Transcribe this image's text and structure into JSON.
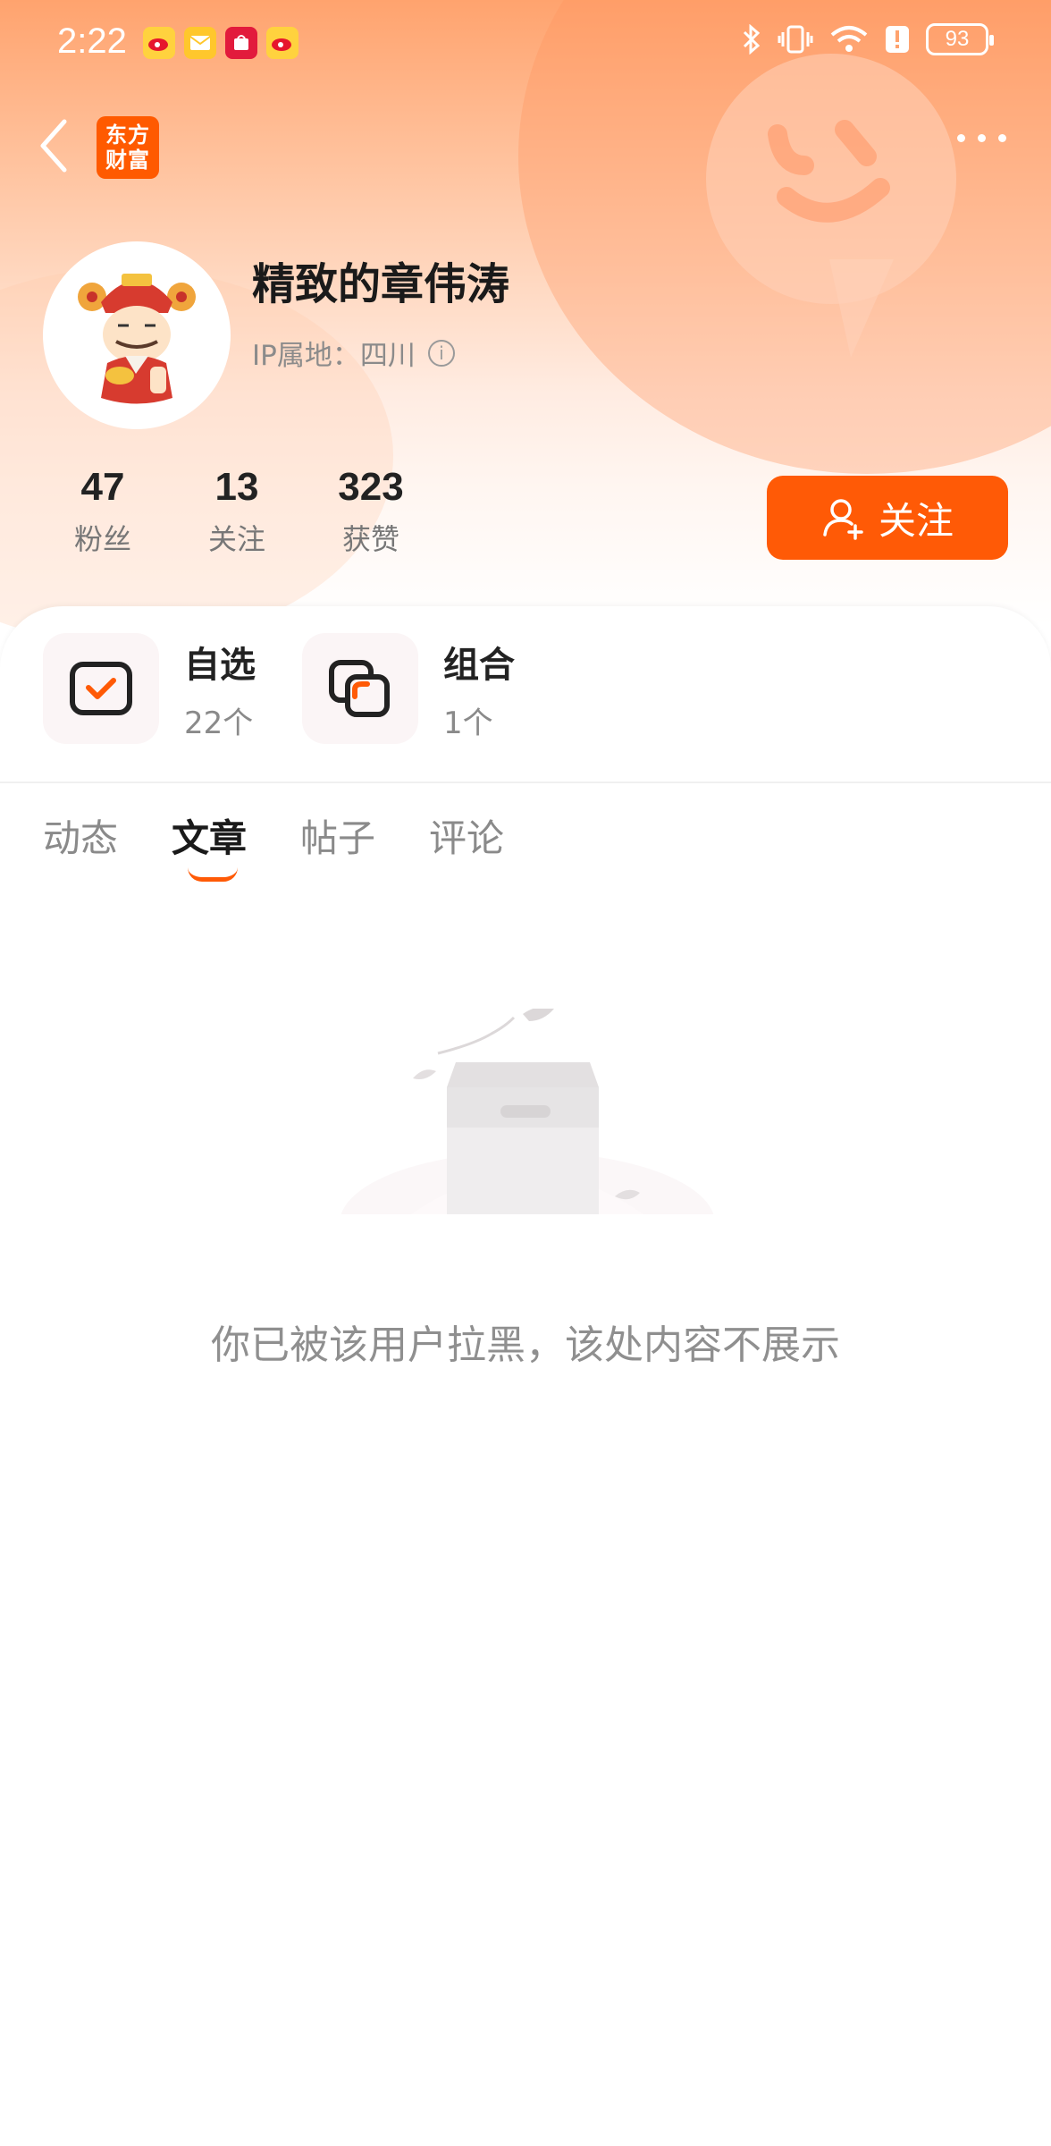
{
  "status_bar": {
    "time": "2:22",
    "notifications": [
      "weibo-icon",
      "mail-icon",
      "shopping-icon",
      "weibo-icon"
    ],
    "battery": "93"
  },
  "nav": {
    "brand_line1": "东方",
    "brand_line2": "财富"
  },
  "profile": {
    "username": "精致的章伟涛",
    "ip_label": "IP属地：四川"
  },
  "stats": [
    {
      "value": "47",
      "label": "粉丝"
    },
    {
      "value": "13",
      "label": "关注"
    },
    {
      "value": "323",
      "label": "获赞"
    }
  ],
  "follow_button": {
    "label": "关注"
  },
  "favorites": [
    {
      "title": "自选",
      "count": "22个"
    },
    {
      "title": "组合",
      "count": "1个"
    }
  ],
  "tabs": [
    {
      "label": "动态",
      "active": false
    },
    {
      "label": "文章",
      "active": true
    },
    {
      "label": "帖子",
      "active": false
    },
    {
      "label": "评论",
      "active": false
    }
  ],
  "empty_state": {
    "message": "你已被该用户拉黑，该处内容不展示"
  },
  "colors": {
    "accent": "#ff5a06",
    "header_gradient_top": "#ffa36e"
  }
}
